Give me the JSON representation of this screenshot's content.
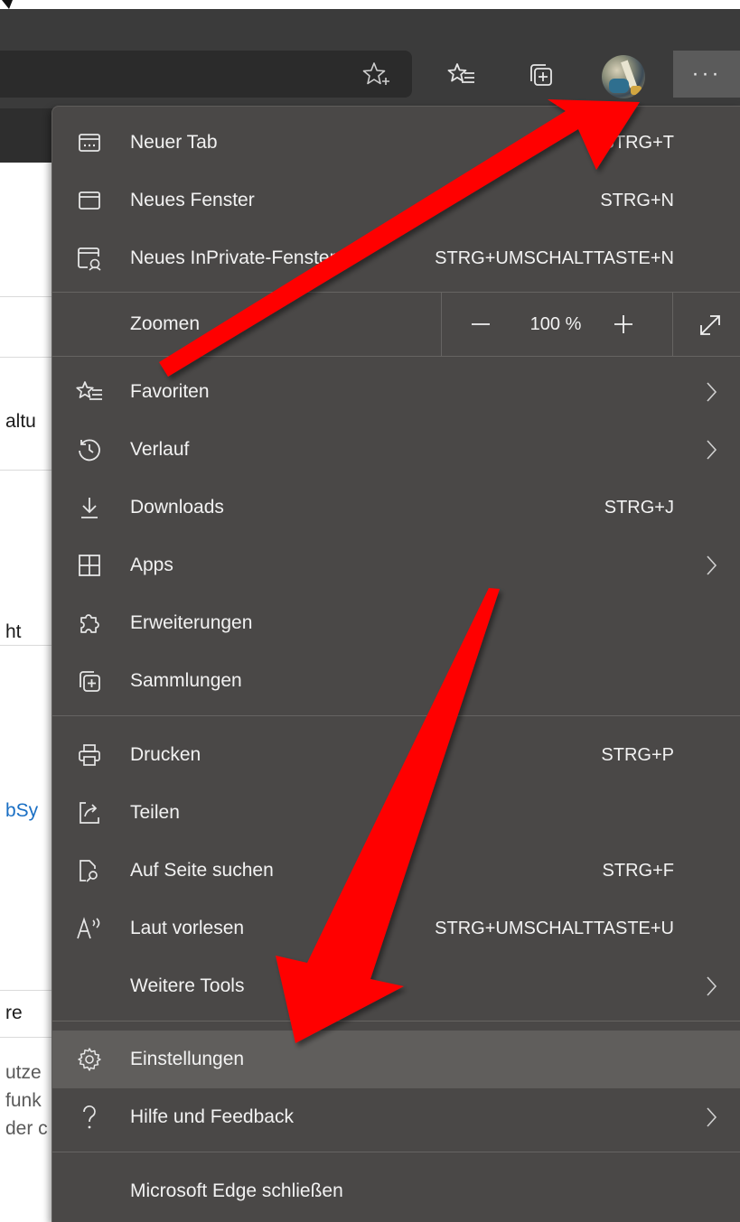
{
  "toolbar": {
    "add_favorite_icon": "star-plus-icon",
    "favorites_icon": "favorites-list-icon",
    "collections_icon": "collections-icon",
    "more_label": "···"
  },
  "page_fragments": [
    "altu",
    "ht",
    "bSy",
    "re",
    "utze",
    "funk",
    "der c"
  ],
  "menu": {
    "items": [
      {
        "label": "Neuer Tab",
        "shortcut": "STRG+T",
        "icon": "new-tab-icon"
      },
      {
        "label": "Neues Fenster",
        "shortcut": "STRG+N",
        "icon": "new-window-icon"
      },
      {
        "label": "Neues InPrivate-Fenster",
        "shortcut": "STRG+UMSCHALTTASTE+N",
        "icon": "inprivate-window-icon"
      },
      {
        "label": "Favoriten",
        "shortcut": "",
        "icon": "favorites-icon"
      },
      {
        "label": "Verlauf",
        "shortcut": "",
        "icon": "history-icon"
      },
      {
        "label": "Downloads",
        "shortcut": "STRG+J",
        "icon": "download-icon"
      },
      {
        "label": "Apps",
        "shortcut": "",
        "icon": "apps-icon"
      },
      {
        "label": "Erweiterungen",
        "shortcut": "",
        "icon": "extensions-icon"
      },
      {
        "label": "Sammlungen",
        "shortcut": "",
        "icon": "collections-icon"
      },
      {
        "label": "Drucken",
        "shortcut": "STRG+P",
        "icon": "print-icon"
      },
      {
        "label": "Teilen",
        "shortcut": "",
        "icon": "share-icon"
      },
      {
        "label": "Auf Seite suchen",
        "shortcut": "STRG+F",
        "icon": "find-icon"
      },
      {
        "label": "Laut vorlesen",
        "shortcut": "STRG+UMSCHALTTASTE+U",
        "icon": "read-aloud-icon"
      },
      {
        "label": "Weitere Tools",
        "shortcut": "",
        "icon": ""
      },
      {
        "label": "Einstellungen",
        "shortcut": "",
        "icon": "gear-icon"
      },
      {
        "label": "Hilfe und Feedback",
        "shortcut": "",
        "icon": "help-icon"
      },
      {
        "label": "Microsoft Edge schließen",
        "shortcut": "",
        "icon": ""
      }
    ],
    "zoom": {
      "label": "Zoomen",
      "minus": "—",
      "value": "100 %",
      "plus": "+"
    }
  },
  "colors": {
    "menu_bg": "#4a4847",
    "highlight_bg": "#605e5c",
    "toolbar_bg": "#3b3b3b",
    "arrow_red": "#ff0000"
  }
}
